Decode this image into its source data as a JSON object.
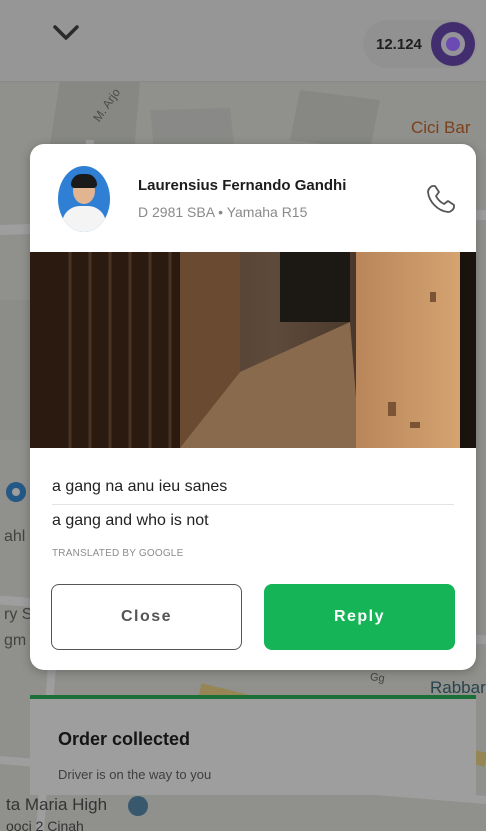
{
  "topbar": {
    "points": "12.124",
    "points_icon": "ring-logo-icon"
  },
  "map": {
    "labels": {
      "street": "M. Arjo",
      "cici": "Cici Bar",
      "rabbar": "Rabbar",
      "ahl": "ahl",
      "rys": "ry S",
      "gm": "gm",
      "maria": "ta Maria High",
      "pool": "ooci 2 Cinah",
      "gang": "Gg"
    }
  },
  "order": {
    "title": "Order collected",
    "subtitle": "Driver is on the way to you"
  },
  "modal": {
    "driver_name": "Laurensius Fernando Gandhi",
    "driver_meta": "D 2981 SBA • Yamaha R15",
    "message_original": "a gang na anu ieu sanes",
    "message_translated": "a gang and who is not",
    "translated_by": "TRANSLATED BY GOOGLE",
    "close_label": "Close",
    "reply_label": "Reply"
  },
  "colors": {
    "accent_green": "#14b457",
    "brand_purple": "#6b4bb3"
  }
}
